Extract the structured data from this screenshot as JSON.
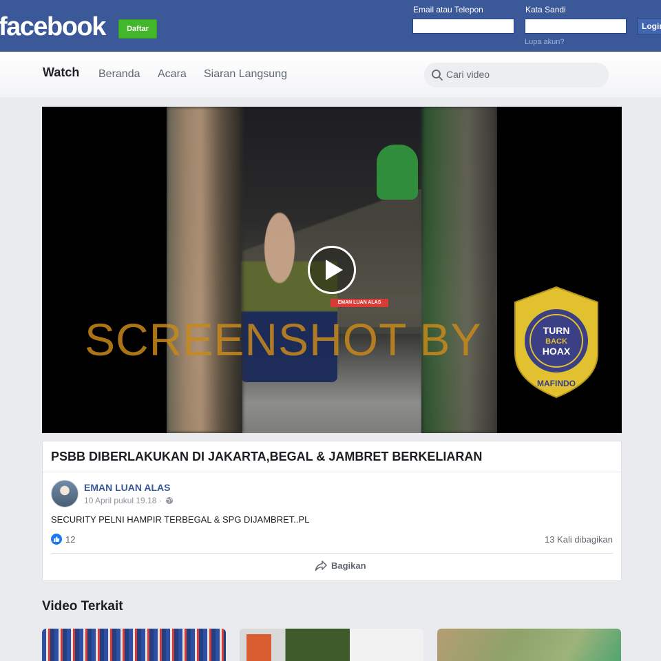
{
  "topbar": {
    "logo": "facebook",
    "signup_label": "Daftar",
    "email_label": "Email atau Telepon",
    "email_value": "",
    "password_label": "Kata Sandi",
    "password_value": "",
    "forgot_label": "Lupa akun?",
    "login_label": "Login",
    "bg_color": "#3b5998"
  },
  "nav": {
    "title": "Watch",
    "items": [
      "Beranda",
      "Acara",
      "Siaran Langsung"
    ],
    "search_placeholder": "Cari video"
  },
  "video": {
    "overlay_tag": "EMAN LUAN ALAS",
    "watermark": "SCREENSHOT BY",
    "badge_top": "MASYARAKAT ANTI FITNAH INDONESIA",
    "badge_center": [
      "TURN",
      "BACK",
      "HOAX"
    ],
    "badge_bottom": "MAFINDO",
    "play_icon": "play-icon"
  },
  "post": {
    "title": "PSBB DIBERLAKUKAN DI JAKARTA,BEGAL & JAMBRET BERKELIARAN",
    "author": "EMAN LUAN ALAS",
    "date": "10 April pukul 19.18 ·",
    "text": "SECURITY PELNI HAMPIR TERBEGAL & SPG DIJAMBRET..PL",
    "likes": "12",
    "shares": "13 Kali dibagikan",
    "share_label": "Bagikan"
  },
  "related": {
    "heading": "Video Terkait"
  }
}
